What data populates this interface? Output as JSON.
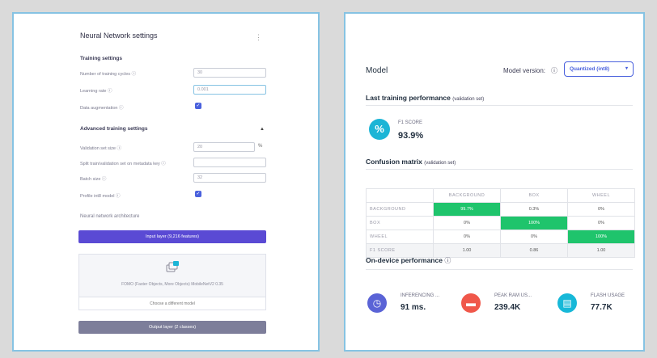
{
  "nn_settings": {
    "title": "Neural Network settings",
    "menu_icon": "kebab-icon",
    "training_section": "Training settings",
    "rows": {
      "cycles": {
        "label": "Number of training cycles ⓘ",
        "value": "30"
      },
      "lr": {
        "label": "Learning rate ⓘ",
        "value": "0.001"
      },
      "aug": {
        "label": "Data augmentation ⓘ",
        "checked": true
      }
    },
    "advanced_section": "Advanced training settings",
    "advanced_rows": {
      "val_size": {
        "label": "Validation set size ⓘ",
        "value": "20",
        "unit": "%"
      },
      "split": {
        "label": "Split train/validation set on metadata key ⓘ",
        "value": ""
      },
      "batch": {
        "label": "Batch size ⓘ",
        "value": "32"
      },
      "profile": {
        "label": "Profile int8 model ⓘ",
        "checked": true
      }
    },
    "architecture_label": "Neural network architecture",
    "input_layer": "Input layer (9,216 features)",
    "model_text": "FOMO (Faster Objects, More Objects) MobileNetV2 0.35",
    "choose_model": "Choose a different model",
    "output_layer": "Output layer (2 classes)"
  },
  "model": {
    "title": "Model",
    "version_label": "Model version:",
    "version_value": "Quantized (int8)",
    "last_training_title": "Last training performance",
    "last_training_sub": "(validation set)",
    "f1_label": "F1 SCORE",
    "f1_value": "93.9%",
    "f1_icon_glyph": "%",
    "confusion_title": "Confusion matrix",
    "confusion_sub": "(validation set)",
    "confusion": {
      "headers": [
        "",
        "BACKGROUND",
        "BOX",
        "WHEEL"
      ],
      "rows": [
        [
          "BACKGROUND",
          "99.7%",
          "0.3%",
          "0%"
        ],
        [
          "BOX",
          "0%",
          "100%",
          "0%"
        ],
        [
          "WHEEL",
          "0%",
          "0%",
          "100%"
        ],
        [
          "F1 SCORE",
          "1.00",
          "0.86",
          "1.00"
        ]
      ]
    },
    "device_title": "On-device performance",
    "device": {
      "inference": {
        "label": "INFERENCING ...",
        "value": "91 ms.",
        "icon": "clock-icon",
        "color": "#5a63d6"
      },
      "ram": {
        "label": "PEAK RAM US...",
        "value": "239.4K",
        "icon": "ram-chip-icon",
        "color": "#f0574a"
      },
      "flash": {
        "label": "FLASH USAGE",
        "value": "77.7K",
        "icon": "flash-storage-icon",
        "color": "#17b8d8"
      }
    }
  },
  "colors": {
    "accent": "#4a61dd",
    "highlight_green": "#1fc46c",
    "panel_border": "#86c3e3"
  }
}
